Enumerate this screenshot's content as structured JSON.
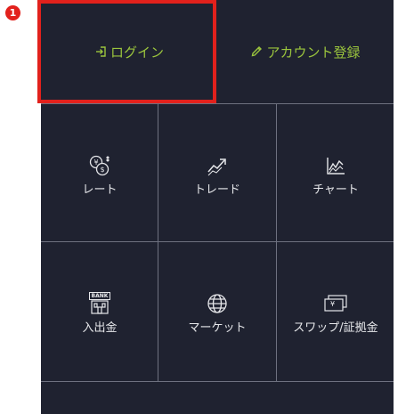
{
  "step_badge": "1",
  "top_actions": {
    "login_label": "ログイン",
    "register_label": "アカウント登録"
  },
  "menu": {
    "items": [
      {
        "label": "レート",
        "icon": "currency-exchange-icon"
      },
      {
        "label": "トレード",
        "icon": "trend-up-icon"
      },
      {
        "label": "チャート",
        "icon": "line-chart-icon"
      },
      {
        "label": "入出金",
        "icon": "bank-icon"
      },
      {
        "label": "マーケット",
        "icon": "globe-icon"
      },
      {
        "label": "スワップ/証拠金",
        "icon": "banknote-icon"
      }
    ]
  },
  "bank_icon_text": "BANK",
  "yen_symbol": "¥",
  "dollar_symbol": "$",
  "colors": {
    "panel_bg": "#1f2230",
    "accent_green": "#9bc53d",
    "highlight_red": "#e2211c",
    "grid_line": "#6e7180",
    "label_text": "#e6e7ea"
  }
}
